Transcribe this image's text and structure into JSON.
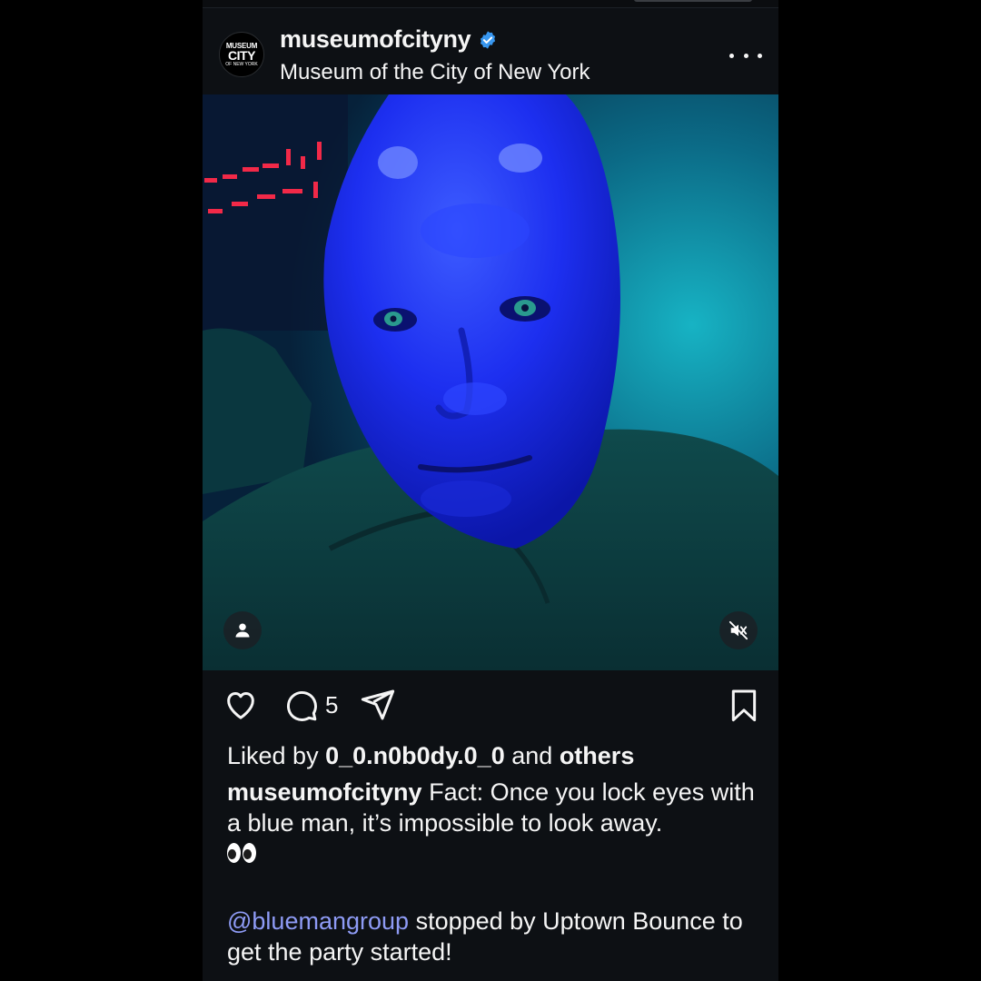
{
  "post": {
    "username": "museumofcityny",
    "subtitle": "Museum of the City of New York",
    "avatar": {
      "line1": "MUSEUM",
      "line2": "CITY",
      "line3": "OF NEW YORK",
      "side": "OF THE"
    },
    "verified_color": "#3897f0"
  },
  "actions": {
    "comment_count": "5"
  },
  "likes": {
    "prefix": "Liked by",
    "user": "0_0.n0b0dy.0_0",
    "middle": "and",
    "others": "others"
  },
  "caption": {
    "username": "museumofcityny",
    "text": "Fact: Once you lock eyes with a blue man, it’s impossible to look away.",
    "emoji": "eyes-emoji",
    "mention": "@bluemangroup",
    "text2": "stopped by Uptown Bounce to get the party started!"
  },
  "colors": {
    "background": "#0d1014",
    "mention": "#8e9bf5",
    "text": "#f5f5f5"
  }
}
